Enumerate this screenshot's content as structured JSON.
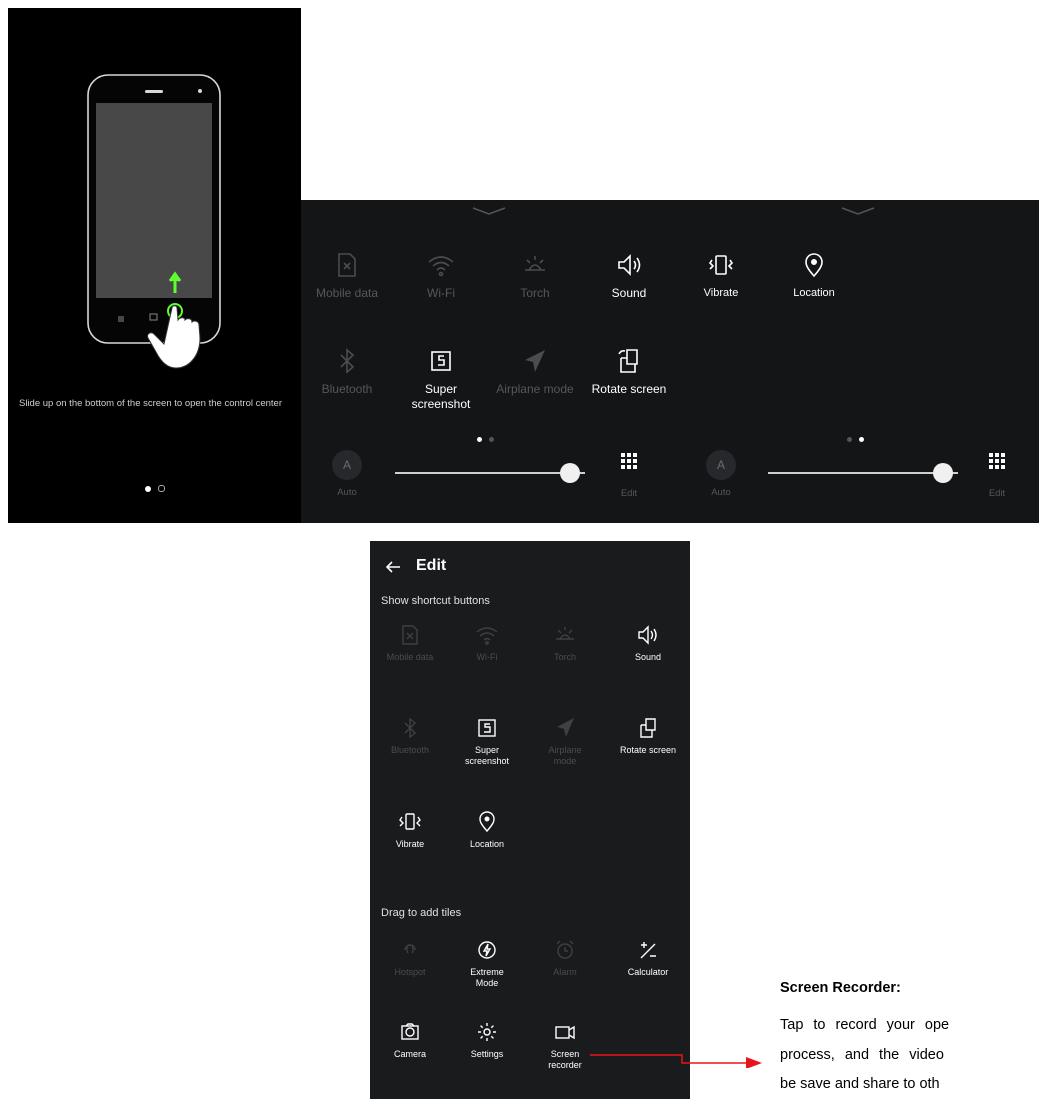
{
  "tutorial": {
    "text": "Slide up on the bottom of the screen to open the control center"
  },
  "control_center_page1": {
    "tiles": [
      {
        "label": "Mobile data",
        "icon": "mobile-data-icon",
        "active": false
      },
      {
        "label": "Wi-Fi",
        "icon": "wifi-icon",
        "active": false
      },
      {
        "label": "Torch",
        "icon": "torch-icon",
        "active": false
      },
      {
        "label": "Sound",
        "icon": "sound-icon",
        "active": true
      },
      {
        "label": "Bluetooth",
        "icon": "bluetooth-icon",
        "active": false
      },
      {
        "label": "Super screenshot",
        "icon": "super-screenshot-icon",
        "active": true
      },
      {
        "label": "Airplane mode",
        "icon": "airplane-icon",
        "active": false
      },
      {
        "label": "Rotate screen",
        "icon": "rotate-screen-icon",
        "active": true
      }
    ],
    "auto_label": "Auto",
    "auto_letter": "A",
    "edit_label": "Edit",
    "brightness": 0.92
  },
  "control_center_page2": {
    "tiles": [
      {
        "label": "Vibrate",
        "icon": "vibrate-icon",
        "active": true
      },
      {
        "label": "Location",
        "icon": "location-icon",
        "active": true
      }
    ],
    "auto_label": "Auto",
    "auto_letter": "A",
    "edit_label": "Edit",
    "brightness": 0.92
  },
  "edit_screen": {
    "title": "Edit",
    "back_icon": "back-arrow-icon",
    "section1": "Show shortcut buttons",
    "shortcuts": [
      {
        "label": "Mobile data",
        "active": false
      },
      {
        "label": "Wi-Fi",
        "active": false
      },
      {
        "label": "Torch",
        "active": false
      },
      {
        "label": "Sound",
        "active": true
      },
      {
        "label": "Bluetooth",
        "active": false
      },
      {
        "label": "Super screenshot",
        "active": true
      },
      {
        "label": "Airplane mode",
        "active": false
      },
      {
        "label": "Rotate screen",
        "active": true
      },
      {
        "label": "Vibrate",
        "active": true
      },
      {
        "label": "Location",
        "active": true
      }
    ],
    "section2": "Drag to add tiles",
    "add_tiles": [
      {
        "label": "Hotspot",
        "active": false
      },
      {
        "label": "Extreme Mode",
        "active": true
      },
      {
        "label": "Alarm",
        "active": false
      },
      {
        "label": "Calculator",
        "active": true
      },
      {
        "label": "Camera",
        "active": true
      },
      {
        "label": "Settings",
        "active": true
      },
      {
        "label": "Screen recorder",
        "active": true
      }
    ]
  },
  "annotation": {
    "title": "Screen Recorder:",
    "line1": "Tap to record your ope",
    "line2": "process, and the video",
    "line3": "be save and share to oth"
  },
  "colors": {
    "panel_bg": "#141517",
    "accent_green": "#5dff2e",
    "arrow_red": "#e8141b"
  }
}
